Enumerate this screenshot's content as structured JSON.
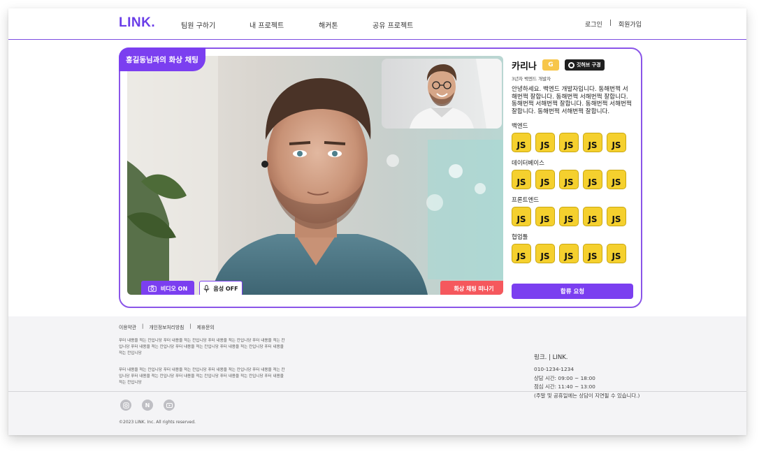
{
  "header": {
    "logo": "LINK.",
    "nav": [
      "팀원 구하기",
      "내 프로젝트",
      "해커톤",
      "공유 프로젝트"
    ],
    "login": "로그인",
    "auth_separator": "|",
    "signup": "회원가입"
  },
  "video_chat": {
    "title": "홍길동님과의 화상 채팅",
    "video_button": "비디오 ON",
    "voice_button": "음성 OFF",
    "leave_button": "화상 채팅 떠나기"
  },
  "profile": {
    "name": "카리나",
    "grade_badge": "G",
    "github_button": "깃허브 구경",
    "career": "3년차 백엔드 개발자",
    "bio": "안녕하세요. 백엔드 개발자입니다. 동해번쩍 서해번쩍 잘합니다. 동해번쩍 서해번쩍 잘합니다. 동해번쩍 서해번쩍 잘합니다. 동해번쩍 서해번쩍 잘합니다. 동해번쩍 서해번쩍 잘합니다.",
    "skill_groups": [
      {
        "title": "백엔드",
        "skills": [
          "JS",
          "JS",
          "JS",
          "JS",
          "JS"
        ]
      },
      {
        "title": "데이터베이스",
        "skills": [
          "JS",
          "JS",
          "JS",
          "JS",
          "JS"
        ]
      },
      {
        "title": "프론트엔드",
        "skills": [
          "JS",
          "JS",
          "JS",
          "JS",
          "JS"
        ]
      },
      {
        "title": "협업툴",
        "skills": [
          "JS",
          "JS",
          "JS",
          "JS",
          "JS"
        ]
      }
    ],
    "join_button": "합류 요청"
  },
  "footer": {
    "links": [
      "이용약관",
      "|",
      "개인정보처리방침",
      "|",
      "제휴문의"
    ],
    "text_1": "푸터 내용을 적는 칸입니당 푸터 내용을 적는 칸입니당 푸터 내용을 적는 칸입니당 푸터 내용을 적는 칸입니당 푸터 내용을 적는 칸입니당 푸터 내용을 적는 칸입니당 푸터 내용을 적는 칸입니당 푸터 내용을 적는 칸입니당",
    "text_2": "푸터 내용을 적는 칸입니당 푸터 내용을 적는 칸입니당 푸터 내용을 적는 칸입니당 푸터 내용을 적는 칸입니당 푸터 내용을 적는 칸입니당 푸터 내용을 적는 칸입니당 푸터 내용을 적는 칸입니당 푸터 내용을 적는 칸입니당",
    "company": "링크. | LINK.",
    "phone": "010-1234-1234",
    "hours": "상담 시간: 09:00 ~ 18:00",
    "lunch": "점심 시간: 11:40 ~ 13:00",
    "notice": "(주말 및 공휴일에는 상담이 지연될 수 있습니다.)",
    "social_icons": [
      "instagram-icon",
      "naver-icon",
      "youtube-icon"
    ],
    "naver_letter": "N",
    "copyright": "©2023 LINK. Inc. All rights reserved."
  },
  "colors": {
    "brand": "#7b3ff0",
    "danger": "#f5585d",
    "js_yellow": "#f5d02e",
    "grade_badge": "#f7c64a"
  }
}
